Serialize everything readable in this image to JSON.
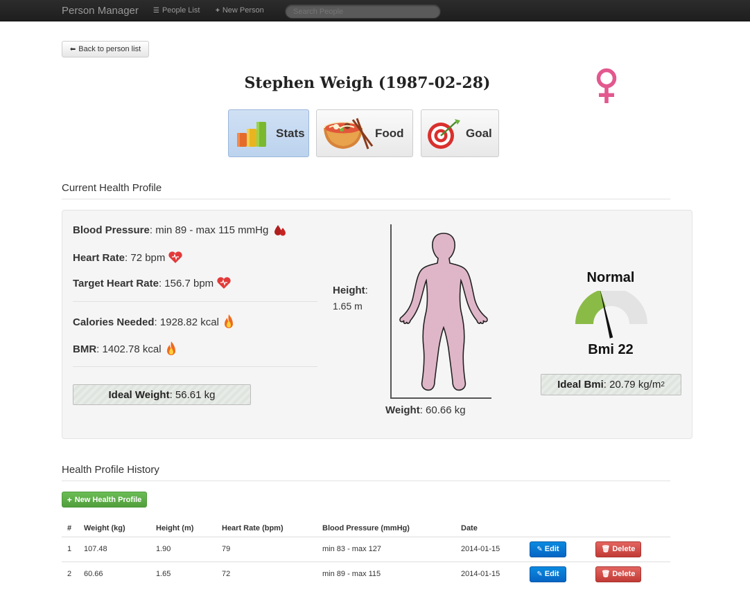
{
  "navbar": {
    "brand": "Person Manager",
    "people_list": "People List",
    "new_person": "New Person",
    "search_placeholder": "Search People"
  },
  "back_button": "Back to person list",
  "person": {
    "title": "Stephen Weigh (1987-02-28)"
  },
  "tabs": [
    {
      "label": "Stats",
      "icon": "bar-chart-icon",
      "active": true
    },
    {
      "label": "Food",
      "icon": "food-bowl-icon",
      "active": false
    },
    {
      "label": "Goal",
      "icon": "target-icon",
      "active": false
    }
  ],
  "current_profile": {
    "heading": "Current Health Profile",
    "blood_pressure": {
      "label": "Blood Pressure",
      "value": ": min 89 - max 115 mmHg"
    },
    "heart_rate": {
      "label": "Heart Rate",
      "value": ": 72 bpm"
    },
    "target_heart_rate": {
      "label": "Target Heart Rate",
      "value": ": 156.7 bpm"
    },
    "calories": {
      "label": "Calories Needed",
      "value": ": 1928.82 kcal"
    },
    "bmr": {
      "label": "BMR",
      "value": ": 1402.78 kcal"
    },
    "ideal_weight": {
      "label": "Ideal Weight",
      "value": ": 56.61 kg"
    },
    "height": {
      "label": "Height",
      "colon": ":",
      "value": "1.65 m"
    },
    "weight": {
      "label": "Weight",
      "value": ": 60.66 kg"
    },
    "bmi_status": "Normal",
    "bmi_label": "Bmi 22",
    "bmi_value": 22,
    "ideal_bmi": {
      "label": "Ideal Bmi",
      "value": ": 20.79 kg/m",
      "sup": "2"
    }
  },
  "history": {
    "heading": "Health Profile History",
    "new_button": "New Health Profile",
    "columns": [
      "#",
      "Weight (kg)",
      "Height (m)",
      "Heart Rate (bpm)",
      "Blood Pressure (mmHg)",
      "Date",
      "",
      ""
    ],
    "rows": [
      {
        "num": "1",
        "weight": "107.48",
        "height": "1.90",
        "heart_rate": "79",
        "bp": "min 83 - max 127",
        "date": "2014-01-15"
      },
      {
        "num": "2",
        "weight": "60.66",
        "height": "1.65",
        "heart_rate": "72",
        "bp": "min 89 - max 115",
        "date": "2014-01-15"
      }
    ],
    "edit_label": "Edit",
    "delete_label": "Delete"
  },
  "colors": {
    "navbar": "#222222",
    "female_symbol": "#e2588f",
    "gauge_fill": "#8bbb47",
    "body_fill": "#dfb6c8",
    "edit_button": "#0a7ad6",
    "delete_button": "#d14a45",
    "new_button": "#5fae49"
  }
}
